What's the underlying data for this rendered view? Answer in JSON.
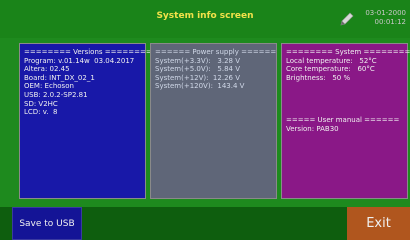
{
  "header": {
    "title": "System info screen",
    "date": "03-01-2000",
    "time": "00:01:12",
    "icon": "pen-icon"
  },
  "versions": {
    "lines": [
      "======== Versions ========",
      "Program: v.01.14w  03.04.2017",
      "Altera: 02.45",
      "Board: INT_DX_02_1",
      "OEM: Echoson",
      "USB: 2.0.2-SP2.81",
      "SD: V2HC",
      "LCD: v.  8"
    ]
  },
  "power": {
    "lines": [
      "====== Power supply ======",
      "System(+3.3V):   3.28 V",
      "System(+5.0V):   5.84 V",
      "System(+12V):  12.26 V",
      "System(+120V):  143.4 V"
    ]
  },
  "system": {
    "lines": [
      "======== System ========",
      "Local temperature:   52°C",
      "Core temperature:   60°C",
      "Brightness:   50 %"
    ],
    "manual_lines": [
      "===== User manual ======",
      "Version: PAB30"
    ]
  },
  "footer": {
    "save_label": "Save to USB",
    "exit_label": "Exit"
  },
  "colors": {
    "background": "#1e8a1e",
    "title": "#f2e14a",
    "versions_panel": "#1818a8",
    "power_panel": "#5f6678",
    "system_panel": "#8a1887",
    "exit_button": "#b0561e"
  }
}
